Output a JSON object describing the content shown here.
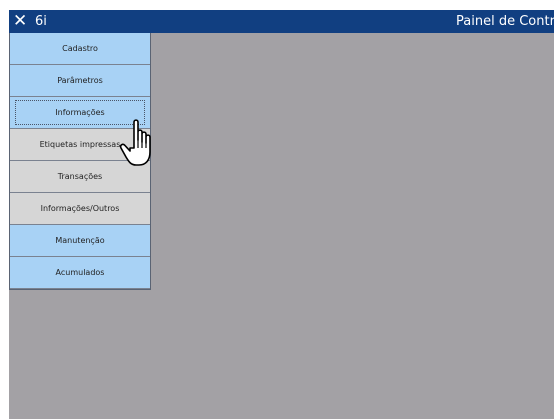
{
  "window": {
    "close_glyph": "✕",
    "app_name": "6i",
    "panel_title": "Painel de Controle"
  },
  "menu": {
    "items": [
      {
        "label": "Cadastro",
        "style": "blue"
      },
      {
        "label": "Parâmetros",
        "style": "blue"
      },
      {
        "label": "Informações",
        "style": "blue",
        "selected": true
      },
      {
        "label": "Etiquetas impressas",
        "style": "gray"
      },
      {
        "label": "Transações",
        "style": "gray"
      },
      {
        "label": "Informações/Outros",
        "style": "gray"
      },
      {
        "label": "Manutenção",
        "style": "blue"
      },
      {
        "label": "Acumulados",
        "style": "blue"
      }
    ]
  },
  "cursor": {
    "icon": "hand-pointer-icon"
  },
  "colors": {
    "titlebar": "#113f81",
    "content_bg": "#a3a1a5",
    "menu_blue": "#a8d2f5",
    "menu_gray": "#d6d6d6"
  }
}
